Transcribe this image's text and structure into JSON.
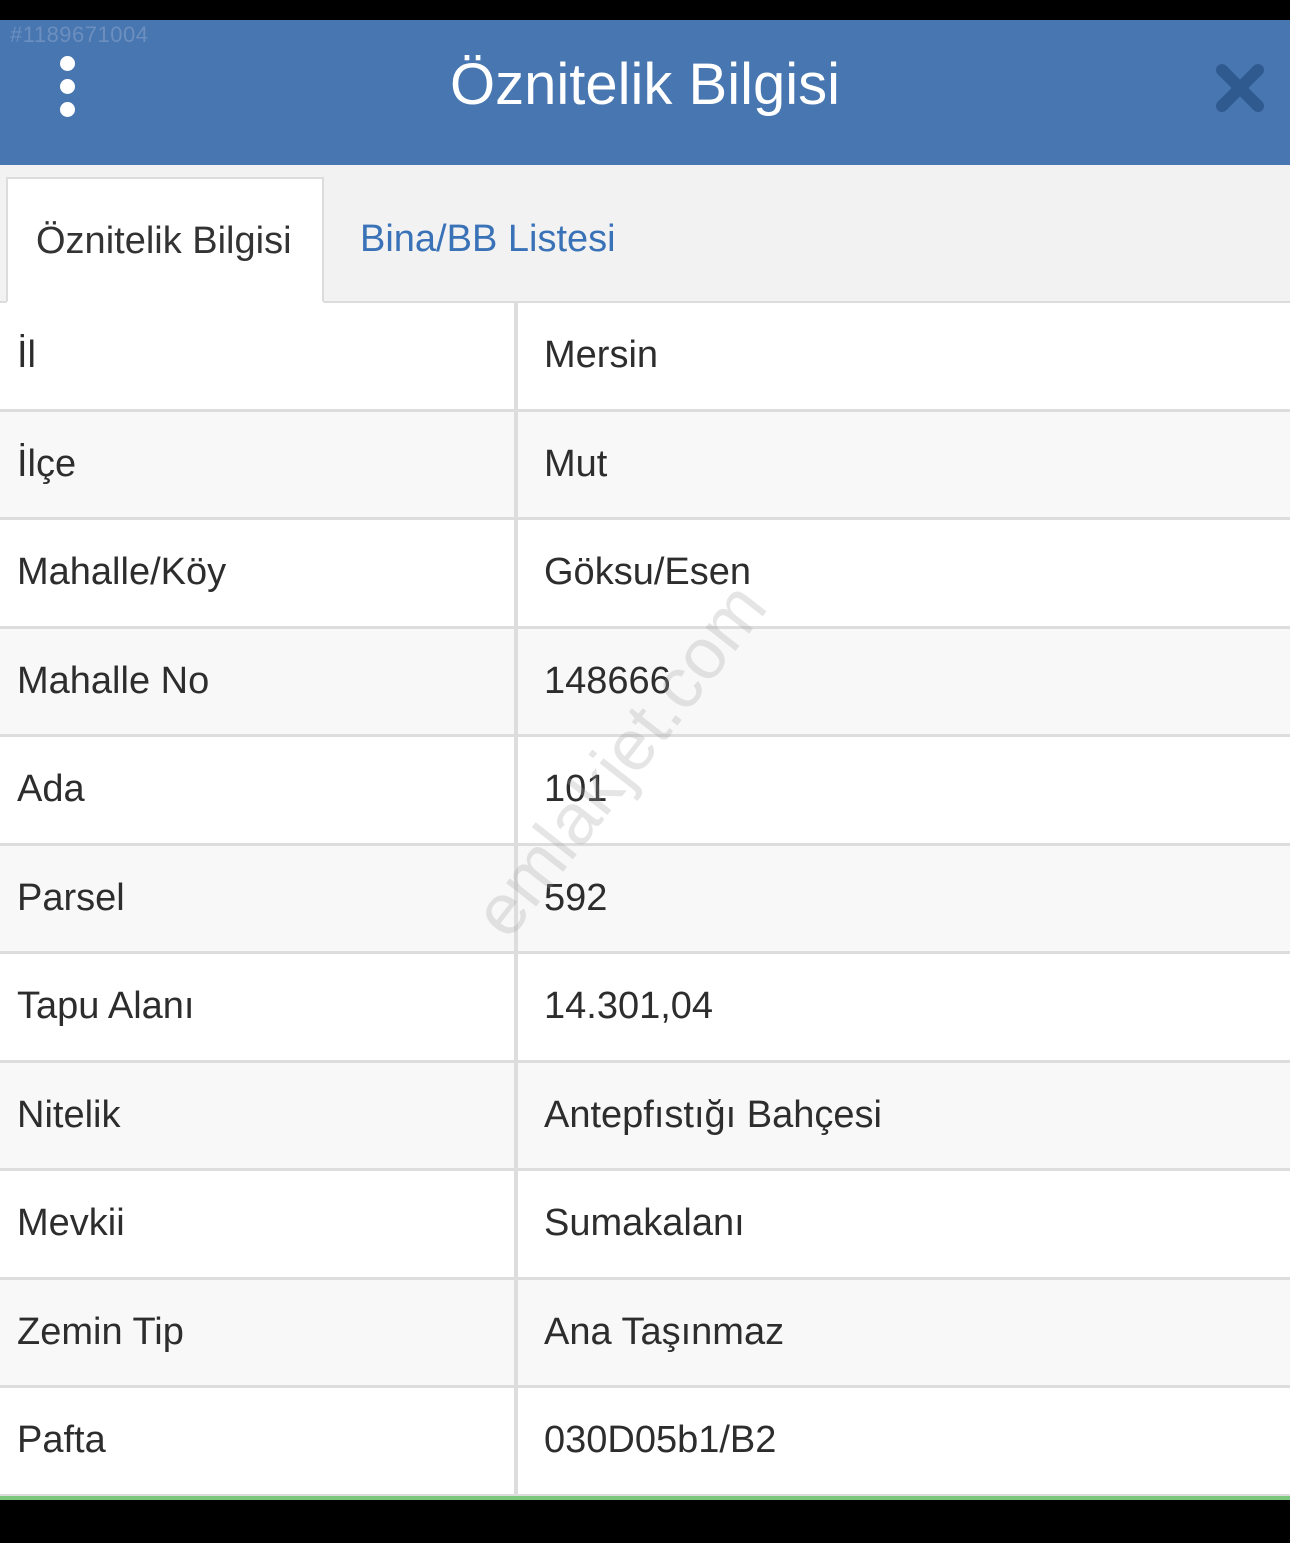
{
  "listing_id": "#1189671004",
  "header": {
    "title": "Öznitelik Bilgisi",
    "menu_icon": "vertical-dots-icon",
    "close_icon": "close-x-icon",
    "background_color": "#4776b0"
  },
  "tabs": [
    {
      "label": "Öznitelik Bilgisi",
      "active": true
    },
    {
      "label": "Bina/BB Listesi",
      "active": false,
      "color": "#3a72b8"
    }
  ],
  "attributes": [
    {
      "label": "İl",
      "value": "Mersin"
    },
    {
      "label": "İlçe",
      "value": "Mut"
    },
    {
      "label": "Mahalle/Köy",
      "value": "Göksu/Esen"
    },
    {
      "label": "Mahalle No",
      "value": "148666"
    },
    {
      "label": "Ada",
      "value": "101"
    },
    {
      "label": "Parsel",
      "value": "592"
    },
    {
      "label": "Tapu Alanı",
      "value": "14.301,04"
    },
    {
      "label": "Nitelik",
      "value": "Antepfıstığı Bahçesi"
    },
    {
      "label": "Mevkii",
      "value": "Sumakalanı"
    },
    {
      "label": "Zemin Tip",
      "value": "Ana Taşınmaz"
    },
    {
      "label": "Pafta",
      "value": "030D05b1/B2"
    }
  ],
  "watermark": "emlakjet.com"
}
